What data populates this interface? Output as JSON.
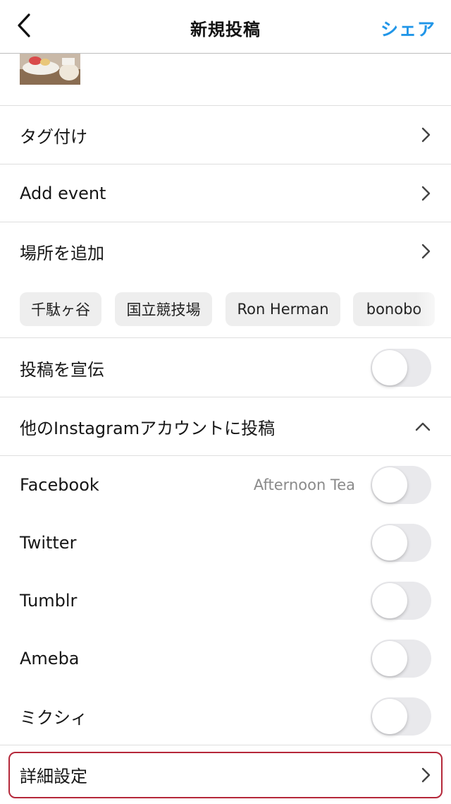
{
  "header": {
    "title": "新規投稿",
    "share_label": "シェア",
    "accent_color": "#2196e8",
    "back_icon": "chevron-left-icon"
  },
  "rows": {
    "tag": "タグ付け",
    "event": "Add event",
    "location": "場所を追加",
    "promote": "投稿を宣伝",
    "other_accounts": "他のInstagramアカウントに投稿",
    "advanced": "詳細設定"
  },
  "location_suggestions": [
    "千駄ヶ谷",
    "国立競技場",
    "Ron Herman",
    "bonobo"
  ],
  "accounts": [
    {
      "name": "Facebook",
      "detail": "Afternoon Tea",
      "enabled": false
    },
    {
      "name": "Twitter",
      "enabled": false
    },
    {
      "name": "Tumblr",
      "enabled": false
    },
    {
      "name": "Ameba",
      "enabled": false
    },
    {
      "name": "ミクシィ",
      "enabled": false
    }
  ],
  "promote_enabled": false,
  "highlight_color": "#b5283a"
}
